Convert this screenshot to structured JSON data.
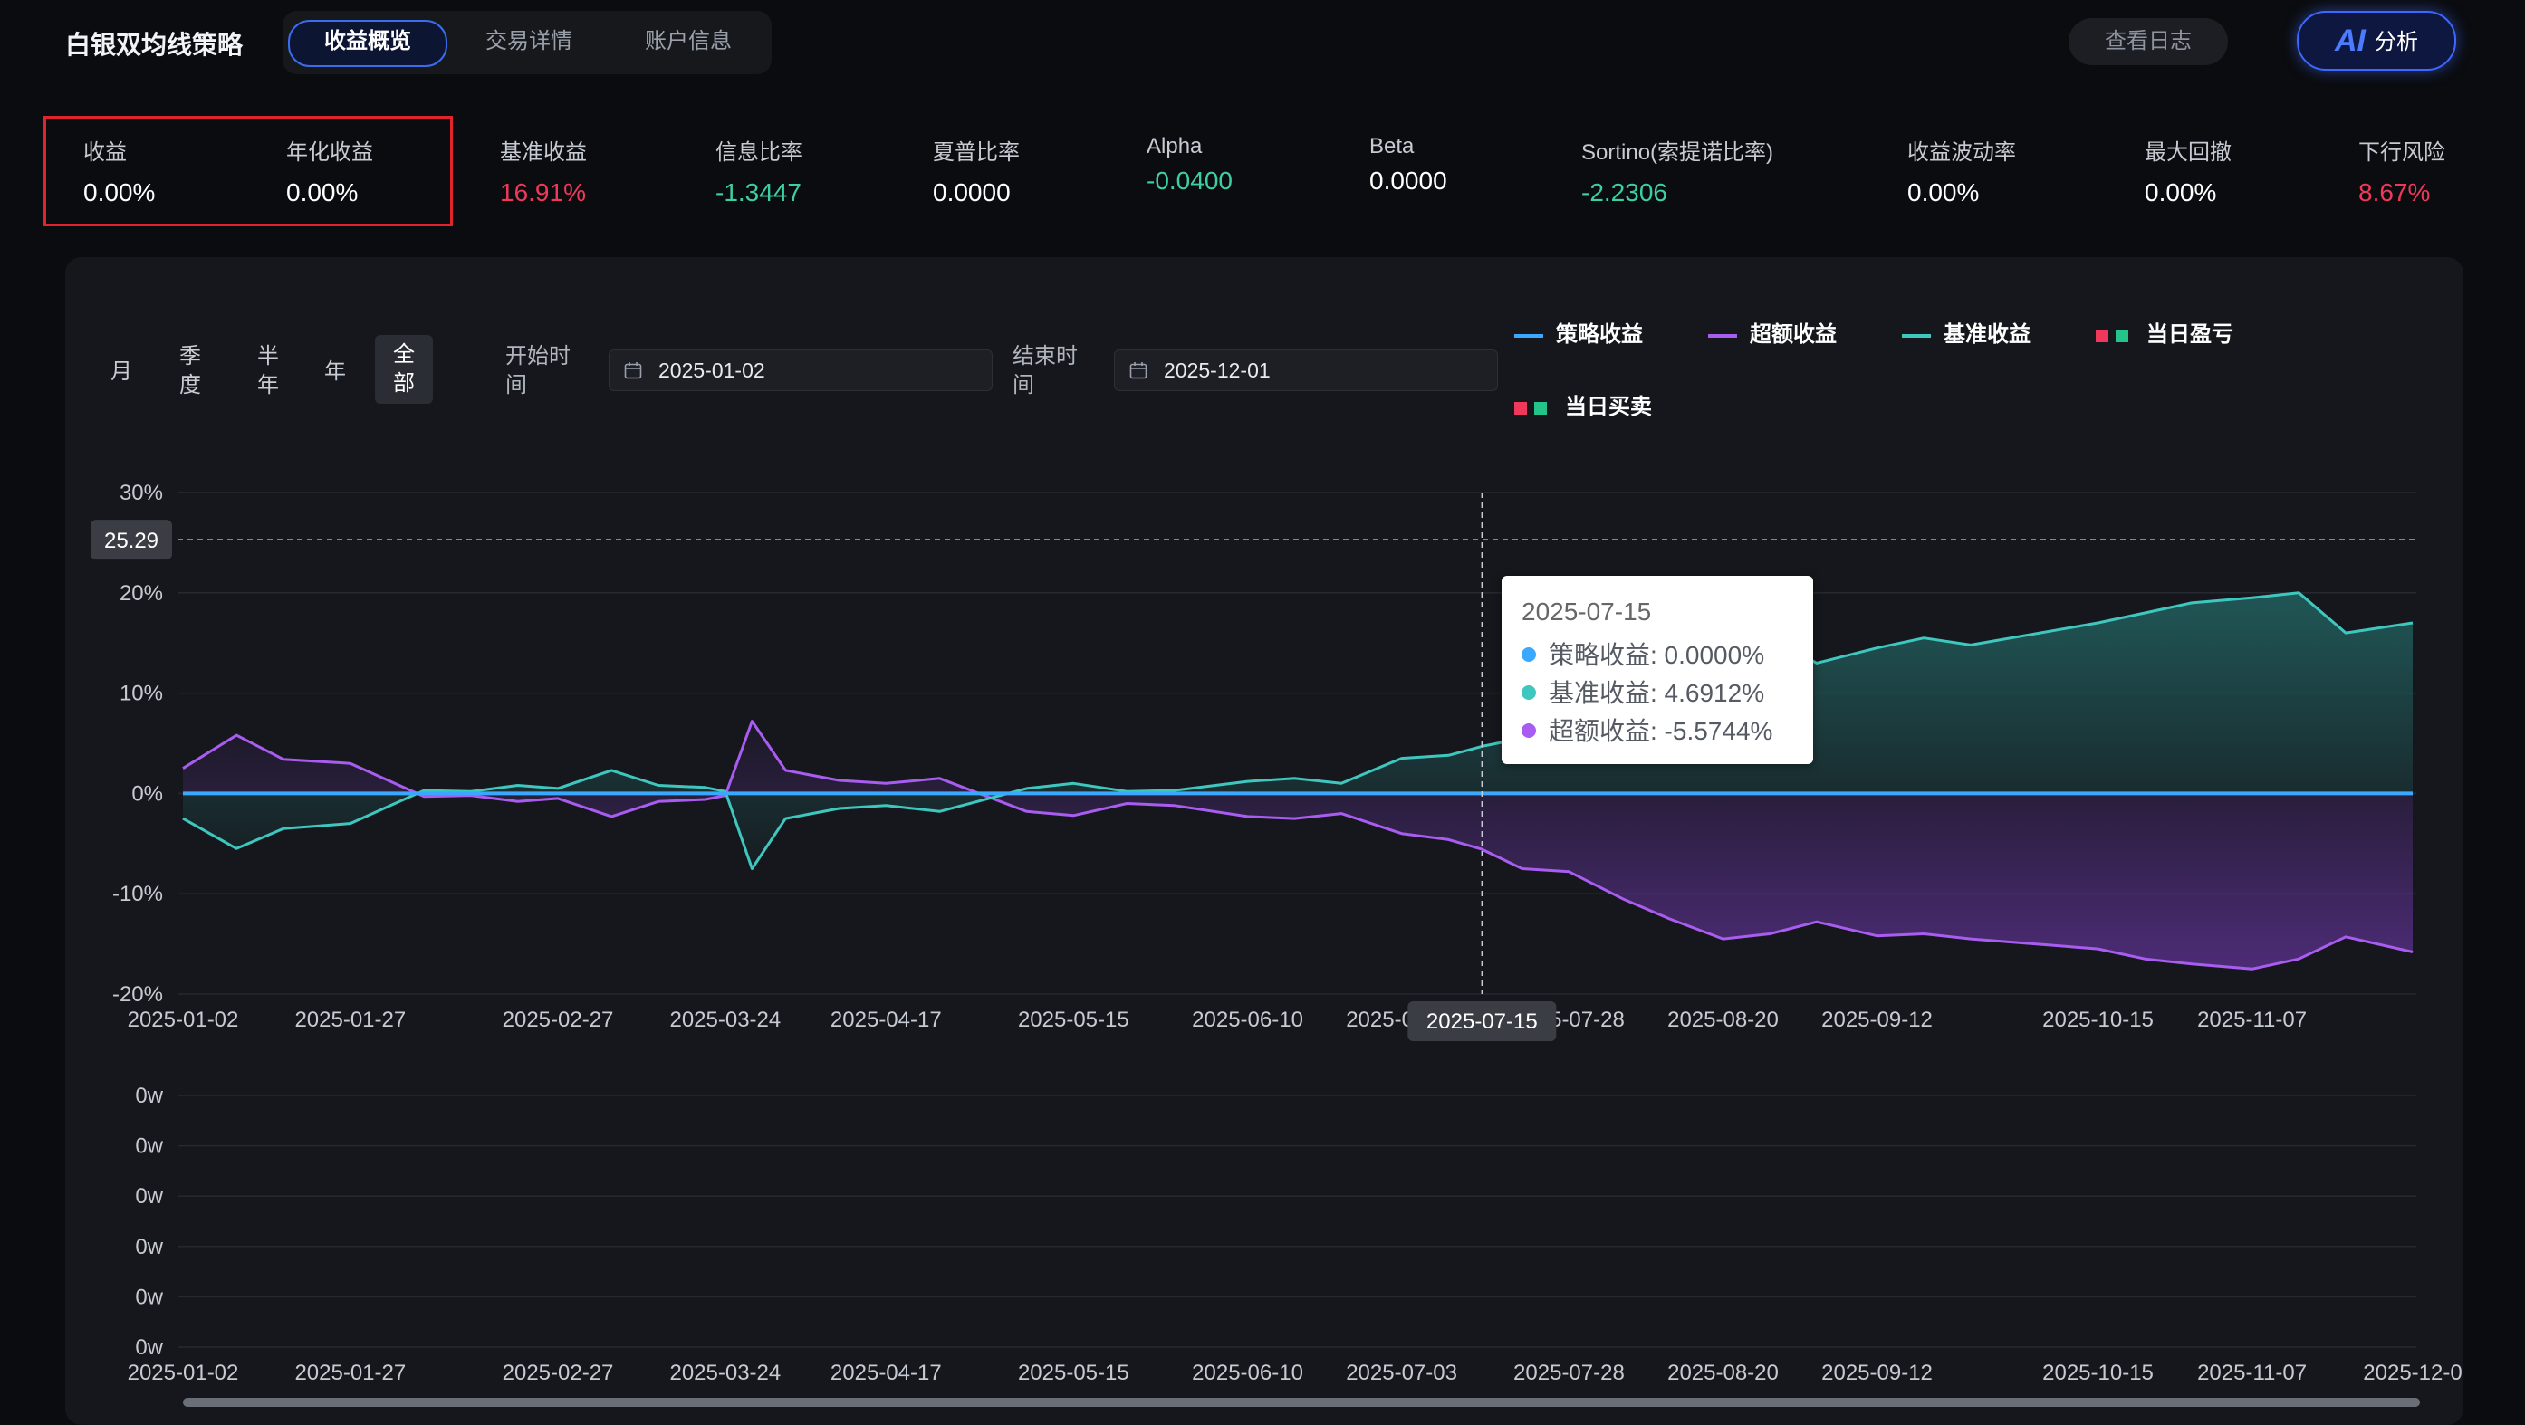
{
  "header": {
    "app_title": "白银双均线策略",
    "tabs": [
      {
        "label": "收益概览",
        "active": true
      },
      {
        "label": "交易详情",
        "active": false
      },
      {
        "label": "账户信息",
        "active": false
      }
    ],
    "log_button": "查看日志",
    "ai_button": {
      "icon": "AI",
      "label": "分析"
    }
  },
  "metrics": [
    {
      "label": "收益",
      "value": "0.00%",
      "tone": "neutral"
    },
    {
      "label": "年化收益",
      "value": "0.00%",
      "tone": "neutral"
    },
    {
      "label": "基准收益",
      "value": "16.91%",
      "tone": "red"
    },
    {
      "label": "信息比率",
      "value": "-1.3447",
      "tone": "green"
    },
    {
      "label": "夏普比率",
      "value": "0.0000",
      "tone": "neutral"
    },
    {
      "label": "Alpha",
      "value": "-0.0400",
      "tone": "green"
    },
    {
      "label": "Beta",
      "value": "0.0000",
      "tone": "neutral"
    },
    {
      "label": "Sortino(索提诺比率)",
      "value": "-2.2306",
      "tone": "green"
    },
    {
      "label": "收益波动率",
      "value": "0.00%",
      "tone": "neutral"
    },
    {
      "label": "最大回撤",
      "value": "0.00%",
      "tone": "neutral"
    },
    {
      "label": "下行风险",
      "value": "8.67%",
      "tone": "red"
    }
  ],
  "controls": {
    "periods": [
      {
        "label": "月",
        "active": false
      },
      {
        "label": "季度",
        "active": false
      },
      {
        "label": "半年",
        "active": false
      },
      {
        "label": "年",
        "active": false
      },
      {
        "label": "全部",
        "active": true
      }
    ],
    "start_label": "开始时间",
    "start_date": "2025-01-02",
    "end_label": "结束时间",
    "end_date": "2025-12-01"
  },
  "legend": [
    {
      "label": "策略收益",
      "kind": "line",
      "color": "#3aa8ff"
    },
    {
      "label": "超额收益",
      "kind": "line",
      "color": "#a95cf0"
    },
    {
      "label": "基准收益",
      "kind": "line",
      "color": "#3ec7be"
    },
    {
      "label": "当日盈亏",
      "kind": "squares",
      "colors": [
        "#f0385a",
        "#23c38a"
      ]
    },
    {
      "label": "当日买卖",
      "kind": "squares",
      "colors": [
        "#f0385a",
        "#23c38a"
      ]
    }
  ],
  "tooltip": {
    "date": "2025-07-15",
    "rows": [
      {
        "label": "策略收益: 0.0000%",
        "color": "#3aa8ff"
      },
      {
        "label": "基准收益: 4.6912%",
        "color": "#3ec7be"
      },
      {
        "label": "超额收益: -5.5744%",
        "color": "#a95cf0"
      }
    ]
  },
  "crosshair": {
    "y_value_label": "25.29",
    "y_value": 25.29,
    "x_label": "2025-07-15",
    "x_value": "2025-07-15"
  },
  "chart_data": [
    {
      "type": "line",
      "x_tick_labels": [
        "2025-01-02",
        "2025-01-27",
        "2025-02-27",
        "2025-03-24",
        "2025-04-17",
        "2025-05-15",
        "2025-06-10",
        "2025-07-03",
        "2025-07-28",
        "2025-08-20",
        "2025-09-12",
        "2025-10-15",
        "2025-11-07"
      ],
      "y_tick_labels": [
        "30%",
        "20%",
        "10%",
        "0%",
        "-10%",
        "-20%"
      ],
      "ylim": [
        -20,
        30
      ],
      "y_unit": "%",
      "grid": true,
      "x": [
        "2025-01-02",
        "2025-01-10",
        "2025-01-17",
        "2025-01-27",
        "2025-02-07",
        "2025-02-14",
        "2025-02-21",
        "2025-02-27",
        "2025-03-07",
        "2025-03-14",
        "2025-03-21",
        "2025-03-24",
        "2025-03-28",
        "2025-04-02",
        "2025-04-10",
        "2025-04-17",
        "2025-04-25",
        "2025-05-08",
        "2025-05-15",
        "2025-05-23",
        "2025-05-30",
        "2025-06-10",
        "2025-06-17",
        "2025-06-24",
        "2025-07-03",
        "2025-07-10",
        "2025-07-15",
        "2025-07-21",
        "2025-07-28",
        "2025-08-05",
        "2025-08-12",
        "2025-08-20",
        "2025-08-27",
        "2025-09-03",
        "2025-09-12",
        "2025-09-19",
        "2025-09-26",
        "2025-10-15",
        "2025-10-22",
        "2025-10-29",
        "2025-11-07",
        "2025-11-14",
        "2025-11-21",
        "2025-12-01"
      ],
      "series": [
        {
          "name": "策略收益",
          "color": "#3aa8ff",
          "values": [
            0,
            0,
            0,
            0,
            0,
            0,
            0,
            0,
            0,
            0,
            0,
            0,
            0,
            0,
            0,
            0,
            0,
            0,
            0,
            0,
            0,
            0,
            0,
            0,
            0,
            0,
            0,
            0,
            0,
            0,
            0,
            0,
            0,
            0,
            0,
            0,
            0,
            0,
            0,
            0,
            0,
            0,
            0,
            0
          ]
        },
        {
          "name": "基准收益",
          "color": "#3ec7be",
          "values": [
            -2.5,
            -5.5,
            -3.5,
            -3.0,
            0.3,
            0.2,
            0.8,
            0.5,
            2.3,
            0.8,
            0.6,
            0.2,
            -7.5,
            -2.5,
            -1.5,
            -1.2,
            -1.8,
            0.5,
            1.0,
            0.2,
            0.3,
            1.2,
            1.5,
            1.0,
            3.5,
            3.8,
            4.69,
            5.5,
            8.0,
            10.5,
            12.5,
            14.5,
            15.5,
            13.0,
            14.5,
            15.5,
            14.8,
            17.0,
            18.0,
            19.0,
            19.5,
            20.0,
            16.0,
            17.0
          ]
        },
        {
          "name": "超额收益",
          "color": "#a95cf0",
          "values": [
            2.5,
            5.8,
            3.4,
            3.0,
            -0.3,
            -0.2,
            -0.8,
            -0.5,
            -2.3,
            -0.8,
            -0.6,
            -0.2,
            7.2,
            2.3,
            1.3,
            1.0,
            1.5,
            -1.8,
            -2.2,
            -1.0,
            -1.2,
            -2.3,
            -2.5,
            -2.0,
            -4.0,
            -4.6,
            -5.57,
            -7.5,
            -7.8,
            -10.5,
            -12.5,
            -14.5,
            -14.0,
            -12.8,
            -14.2,
            -14.0,
            -14.5,
            -15.5,
            -16.5,
            -17.0,
            -17.5,
            -16.5,
            -14.3,
            -15.8
          ]
        }
      ]
    },
    {
      "type": "bar",
      "x_tick_labels": [
        "2025-01-02",
        "2025-01-27",
        "2025-02-27",
        "2025-03-24",
        "2025-04-17",
        "2025-05-15",
        "2025-06-10",
        "2025-07-03",
        "2025-07-28",
        "2025-08-20",
        "2025-09-12",
        "2025-10-15",
        "2025-11-07",
        "2025-12-0"
      ],
      "y_tick_labels": [
        "0w",
        "0w",
        "0w",
        "0w",
        "0w",
        "0w"
      ],
      "grid": true
    }
  ]
}
